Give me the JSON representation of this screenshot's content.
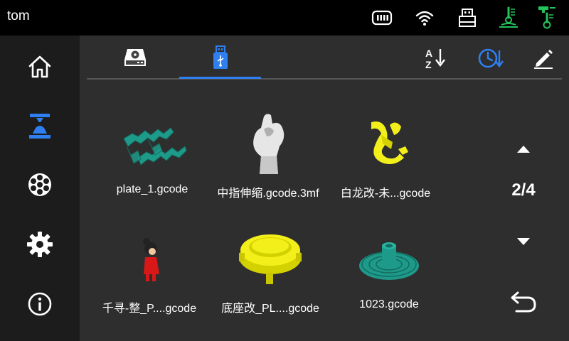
{
  "topbar": {
    "title": "tom",
    "icons": [
      "storage-icon",
      "wifi-icon",
      "usb-drive-icon",
      "nozzle-temperature-icon",
      "bed-temperature-icon"
    ]
  },
  "sidebar": {
    "items": [
      {
        "name": "home",
        "icon": "home-icon",
        "active": false
      },
      {
        "name": "print",
        "icon": "printer-nozzle-icon",
        "active": true
      },
      {
        "name": "filament",
        "icon": "filament-spool-icon",
        "active": false
      },
      {
        "name": "settings",
        "icon": "gear-icon",
        "active": false
      },
      {
        "name": "info",
        "icon": "info-icon",
        "active": false
      }
    ]
  },
  "tabs": [
    {
      "name": "internal-storage",
      "icon": "hard-drive-icon",
      "active": false
    },
    {
      "name": "usb",
      "icon": "usb-icon",
      "active": true
    }
  ],
  "toolbar": {
    "icons": [
      "sort-az-icon",
      "sort-time-icon",
      "edit-icon"
    ]
  },
  "files": [
    {
      "name": "plate_1.gcode",
      "thumb_color": "#1e9a8a"
    },
    {
      "name": "中指伸缩.gcode.3mf",
      "thumb_color": "#e6e6e6"
    },
    {
      "name": "白龙改-未...gcode",
      "thumb_color": "#f2ef1a"
    },
    {
      "name": "千寻-整_P....gcode",
      "thumb_color": "#d81818"
    },
    {
      "name": "底座改_PL....gcode",
      "thumb_color": "#f2ef1a"
    },
    {
      "name": "1023.gcode",
      "thumb_color": "#1e9a8a"
    }
  ],
  "pager": {
    "indicator": "2/4"
  },
  "colors": {
    "accent": "#2f7ff0",
    "green": "#22c35a",
    "sidebar_bg": "#1c1c1c",
    "main_bg": "#2e2e2e"
  }
}
